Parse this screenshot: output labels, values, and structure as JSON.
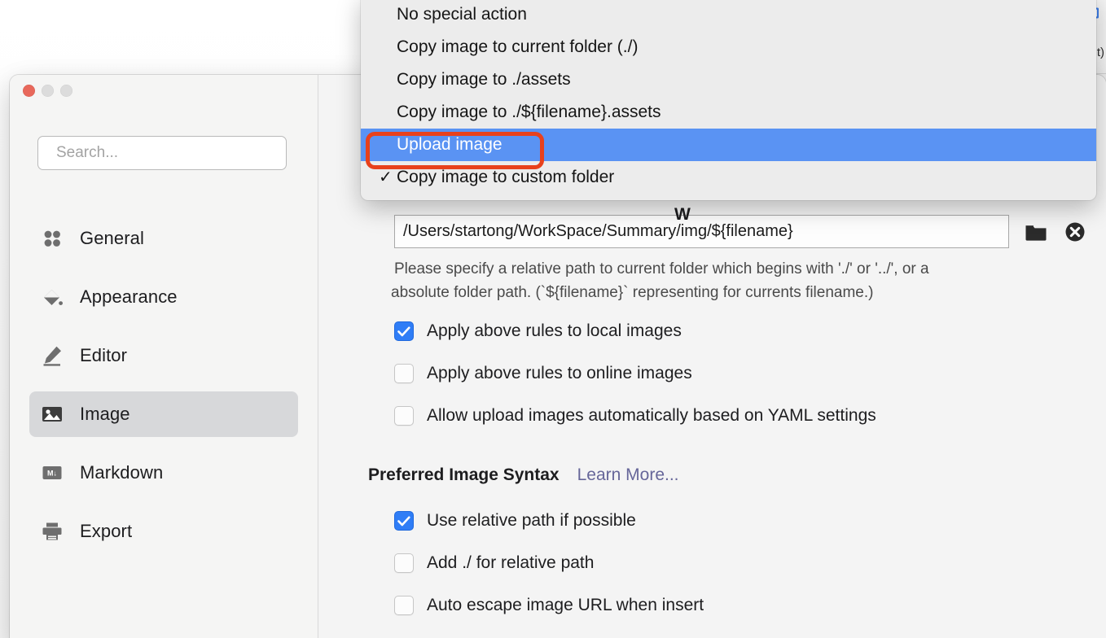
{
  "background_window": {
    "toolbar_icon": "clipboard-icon",
    "cut_off_text": "t)",
    "stepper_icon": "stepper-up-down-icon"
  },
  "prefs_window": {
    "traffic_lights": [
      "close",
      "minimize",
      "maximize"
    ],
    "search": {
      "placeholder": "Search...",
      "value": ""
    },
    "sidebar": {
      "items": [
        {
          "label": "General",
          "icon": "grid-dots-icon",
          "selected": false
        },
        {
          "label": "Appearance",
          "icon": "paint-bucket-icon",
          "selected": false
        },
        {
          "label": "Editor",
          "icon": "pencil-icon",
          "selected": false
        },
        {
          "label": "Image",
          "icon": "image-icon",
          "selected": true
        },
        {
          "label": "Markdown",
          "icon": "markdown-icon",
          "selected": false
        },
        {
          "label": "Export",
          "icon": "printer-icon",
          "selected": false
        }
      ]
    },
    "content": {
      "insert_section_title_peek": "W",
      "custom_folder": {
        "value": "/Users/startong/WorkSpace/Summary/img/${filename}",
        "placeholder": "",
        "folder_button_icon": "folder-icon",
        "clear_button_icon": "clear-circle-x-icon"
      },
      "hint_line1": "Please specify a relative path to current folder which begins with './' or '../', or a",
      "hint_line2": "absolute folder path. (`${filename}` representing for currents filename.)",
      "rules_checkboxes": [
        {
          "label": "Apply above rules to local images",
          "checked": true
        },
        {
          "label": "Apply above rules to online images",
          "checked": false
        },
        {
          "label": "Allow upload images automatically based on YAML settings",
          "checked": false
        }
      ],
      "syntax_section": {
        "title": "Preferred Image Syntax",
        "learn_more": "Learn More..."
      },
      "syntax_checkboxes": [
        {
          "label": "Use relative path if possible",
          "checked": true
        },
        {
          "label": "Add ./ for relative path",
          "checked": false
        },
        {
          "label": "Auto escape image URL when insert",
          "checked": false
        }
      ]
    }
  },
  "dropdown": {
    "items": [
      {
        "label": "No special action",
        "checked": false,
        "highlighted": false
      },
      {
        "label": "Copy image to current folder (./)",
        "checked": false,
        "highlighted": false
      },
      {
        "label": "Copy image to ./assets",
        "checked": false,
        "highlighted": false
      },
      {
        "label": "Copy image to ./${filename}.assets",
        "checked": false,
        "highlighted": false
      },
      {
        "label": "Upload image",
        "checked": false,
        "highlighted": true
      },
      {
        "label": "Copy image to custom folder",
        "checked": true,
        "highlighted": false
      }
    ],
    "check_glyph": "✓"
  },
  "annotation": {
    "type": "rectangle-highlight",
    "color": "#e8411c",
    "targets": "Upload image"
  },
  "colors": {
    "accent_blue": "#2f7df6",
    "menu_highlight": "#5a93f3",
    "annotation_red": "#e8411c",
    "link_purple": "#666699",
    "sidebar_selected": "#d7d8da"
  }
}
